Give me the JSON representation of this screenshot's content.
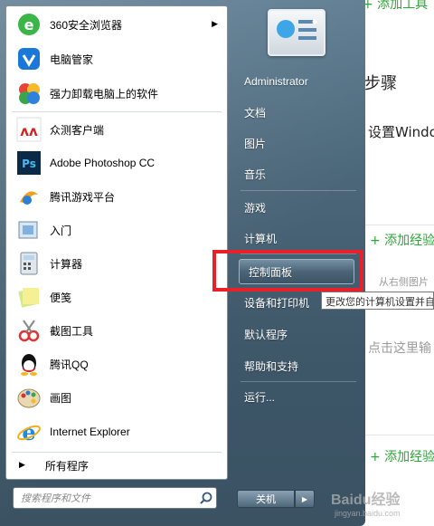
{
  "background_page": {
    "add_tool_text": "+ 添加工具",
    "step_heading": "步骤",
    "step_text": "设置Windo",
    "add_experience_1": "+ 添加经验",
    "drag_hint": "从右侧图片",
    "click_input_hint": "点击这里输",
    "add_experience_2": "+ 添加经验"
  },
  "left_pane": {
    "pinned": [
      {
        "label": "360安全浏览器",
        "icon": "360-browser-icon"
      },
      {
        "label": "电脑管家",
        "icon": "pc-manager-icon"
      },
      {
        "label": "强力卸载电脑上的软件",
        "icon": "uninstall-icon"
      }
    ],
    "recent": [
      {
        "label": "众测客户端",
        "icon": "zhongce-icon"
      },
      {
        "label": "Adobe Photoshop CC",
        "icon": "photoshop-icon"
      },
      {
        "label": "腾讯游戏平台",
        "icon": "tencent-games-icon"
      },
      {
        "label": "入门",
        "icon": "getting-started-icon"
      },
      {
        "label": "计算器",
        "icon": "calculator-icon"
      },
      {
        "label": "便笺",
        "icon": "sticky-notes-icon"
      },
      {
        "label": "截图工具",
        "icon": "snipping-tool-icon"
      },
      {
        "label": "腾讯QQ",
        "icon": "qq-icon"
      },
      {
        "label": "画图",
        "icon": "paint-icon"
      },
      {
        "label": "Internet Explorer",
        "icon": "internet-explorer-icon"
      }
    ],
    "all_programs": "所有程序",
    "search_placeholder": "搜索程序和文件"
  },
  "right_pane": {
    "user": "Administrator",
    "documents": "文档",
    "pictures": "图片",
    "music": "音乐",
    "games": "游戏",
    "computer": "计算机",
    "control_panel": "控制面板",
    "devices_printers": "设备和打印机",
    "default_programs": "默认程序",
    "help_support": "帮助和支持",
    "run": "运行..."
  },
  "tooltip": "更改您的计算机设置并自",
  "shutdown_label": "关机",
  "watermark": "Baidu经验",
  "watermark_url": "jingyan.baidu.com",
  "colors": {
    "highlight_box": "#e8202a",
    "accent_green": "#2fa43a"
  }
}
